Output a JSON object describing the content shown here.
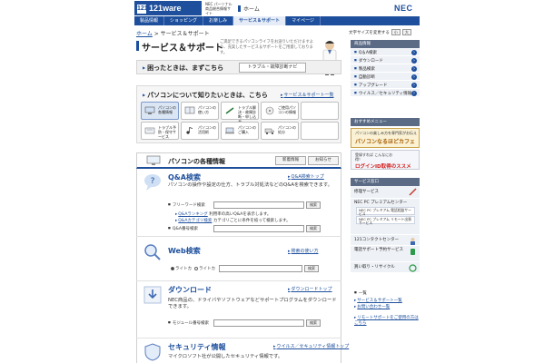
{
  "header": {
    "logo_text": "121ware",
    "logo_mark": "121",
    "logo_sub": "NEC パーソナル商品総合情報サイト",
    "home_label": "ホーム",
    "nec": "NEC"
  },
  "nav": [
    "製品情報",
    "ショッピング",
    "お楽しみ",
    "サービス＆サポート",
    "マイページ"
  ],
  "breadcrumb": {
    "home": "ホーム",
    "sep": " > ",
    "current": "サービス＆サポート"
  },
  "textsize": {
    "label": "文字サイズを変更する",
    "small": "小",
    "large": "大"
  },
  "title": {
    "text": "サービス＆サポート",
    "desc": "ご満足できるパソコンライフをお送りいただけますよう、充実したサービス＆サポートをご用意しております。"
  },
  "trouble": {
    "label": "困ったときは、まずこちら",
    "button": "トラブル・故障診断ナビ"
  },
  "know": {
    "title": "パソコンについて知りたいときは、こちら",
    "link": "サービス＆サポート一覧",
    "items": [
      "パソコンの各種情報",
      "パソコンの使い方",
      "トラブル解決・故障診断・申し込み",
      "ご使用パソコンの情報",
      "",
      "トラブル予防・保守サービス",
      "パソコンの活用術",
      "パソコンのご購入",
      "パソコンの処分",
      ""
    ]
  },
  "info": {
    "title": "パソコンの各種情報",
    "btn1": "新着情報",
    "btn2": "お知らせ"
  },
  "qa": {
    "title": "Q&A検索",
    "link": "Q&A検索トップ",
    "desc": "パソコンの操作や設定の仕方、トラブル対処法などのQ&Aを検索できます。",
    "free_word": "フリーワード検索",
    "search_btn": "検索",
    "ranking_link": "Q&Aランキング",
    "ranking_text": "利用率の高いQ&Aを表示します。",
    "category_link": "Q&Aカテゴリ検索",
    "category_text": "カテゴリごとに条件を絞って検索します。",
    "number_search": "Q&A番号検索"
  },
  "web": {
    "title": "Web検索",
    "link": "検索の使い方",
    "radio1": "ライトカ",
    "radio2": "ライトカ",
    "search_btn": "検索"
  },
  "download": {
    "title": "ダウンロード",
    "link": "ダウンロードトップ",
    "desc": "NEC商品の、ドライバやソフトウェアなどサポートプログラムをダウンロードできます。",
    "model_search": "モジュール番号検索",
    "search_btn": "検索"
  },
  "security": {
    "title": "セキュリティ情報",
    "link": "ウイルス／セキュリティ情報トップ",
    "desc": "マイクロソフト社が公開したセキュリティ情報です。"
  },
  "sidebar": {
    "product_head": "商品情報",
    "products": [
      "Q＆A検索",
      "ダウンロード",
      "製品検索",
      "自動診断",
      "アップグレード",
      "ウイルス／セキュリティ情報"
    ],
    "menu_head": "おすすめメニュー",
    "banner1_t1": "パソコンの楽しみ方を専門家がお伝え",
    "banner1_t2": "パソコンなるほどカフェ",
    "banner2_t1": "登録すれば こんなにお得！",
    "banner2_t2": "ログインID取得のススメ",
    "service_head": "サービス窓口",
    "repair": "修理サービス",
    "nec_pc": "NEC PC プレミアムセンター",
    "sub1": "NEC PC プレミアム 電話相談サービス",
    "sub2": "NEC PC プレミアム リモート出張サービス",
    "contact": "121コンタクトセンター",
    "phone": "電話サポート予約サービス",
    "recycle": "買い取り・リサイクル",
    "list_head": "一覧",
    "list1": "サービス＆サポート一覧",
    "list2": "お問い合わせ一覧",
    "remote": "リモートサポートをご使用の方はこちら"
  }
}
